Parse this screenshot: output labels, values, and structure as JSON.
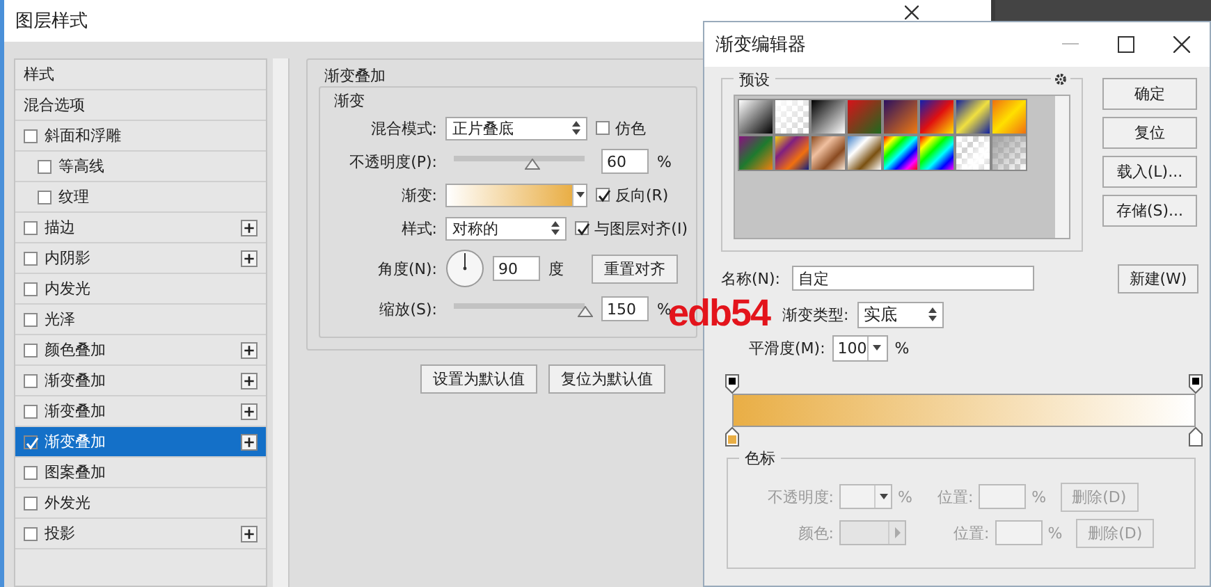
{
  "dialog": {
    "title": "图层样式"
  },
  "styles_list": [
    {
      "label": "样式",
      "kind": "header",
      "selected": false
    },
    {
      "label": "混合选项",
      "kind": "header",
      "selected": false
    },
    {
      "label": "斜面和浮雕",
      "kind": "check",
      "checked": false,
      "selected": false,
      "addable": false
    },
    {
      "label": "等高线",
      "kind": "subcheck",
      "checked": false,
      "selected": false,
      "addable": false
    },
    {
      "label": "纹理",
      "kind": "subcheck",
      "checked": false,
      "selected": false,
      "addable": false
    },
    {
      "label": "描边",
      "kind": "check",
      "checked": false,
      "selected": false,
      "addable": true
    },
    {
      "label": "内阴影",
      "kind": "check",
      "checked": false,
      "selected": false,
      "addable": true
    },
    {
      "label": "内发光",
      "kind": "check",
      "checked": false,
      "selected": false,
      "addable": false
    },
    {
      "label": "光泽",
      "kind": "check",
      "checked": false,
      "selected": false,
      "addable": false
    },
    {
      "label": "颜色叠加",
      "kind": "check",
      "checked": false,
      "selected": false,
      "addable": true
    },
    {
      "label": "渐变叠加",
      "kind": "check",
      "checked": false,
      "selected": false,
      "addable": true
    },
    {
      "label": "渐变叠加",
      "kind": "check",
      "checked": false,
      "selected": false,
      "addable": true
    },
    {
      "label": "渐变叠加",
      "kind": "check",
      "checked": true,
      "selected": true,
      "addable": true
    },
    {
      "label": "图案叠加",
      "kind": "check",
      "checked": false,
      "selected": false,
      "addable": false
    },
    {
      "label": "外发光",
      "kind": "check",
      "checked": false,
      "selected": false,
      "addable": false
    },
    {
      "label": "投影",
      "kind": "check",
      "checked": false,
      "selected": false,
      "addable": true
    }
  ],
  "gradient_overlay": {
    "title": "渐变叠加",
    "group_title": "渐变",
    "blend_mode": {
      "label": "混合模式:",
      "value": "正片叠底"
    },
    "dither": {
      "label": "仿色",
      "checked": false
    },
    "opacity": {
      "label": "不透明度(P):",
      "level": 0.6,
      "value": "60",
      "unit": "%"
    },
    "gradient": {
      "label": "渐变:"
    },
    "reverse": {
      "label": "反向(R)",
      "checked": true
    },
    "style": {
      "label": "样式:",
      "value": "对称的"
    },
    "align": {
      "label": "与图层对齐(I)",
      "checked": true
    },
    "angle": {
      "label": "角度(N):",
      "value": "90",
      "unit": "度"
    },
    "reset_align": "重置对齐",
    "scale": {
      "label": "缩放(S):",
      "level": 1,
      "value": "150",
      "unit": "%"
    },
    "buttons": [
      "设置为默认值",
      "复位为默认值"
    ]
  },
  "annotation": "edb54",
  "gradient_editor": {
    "title": "渐变编辑器",
    "presets_title": "预设",
    "presets": [
      {
        "kind": "gradient"
      },
      {
        "kind": "transparent"
      },
      {
        "kind": "gradient"
      },
      {
        "kind": "gradient"
      },
      {
        "kind": "gradient"
      },
      {
        "kind": "gradient"
      },
      {
        "kind": "gradient"
      },
      {
        "kind": "gradient"
      },
      {
        "kind": "gradient"
      },
      {
        "kind": "gradient"
      },
      {
        "kind": "gradient"
      },
      {
        "kind": "gradient"
      },
      {
        "kind": "gradient"
      },
      {
        "kind": "transparent"
      },
      {
        "kind": "transparent"
      },
      {
        "kind": "transparent"
      }
    ],
    "buttons": [
      "确定",
      "复位",
      "载入(L)...",
      "存储(S)..."
    ],
    "name": {
      "label": "名称(N):",
      "value": "自定"
    },
    "new_button": "新建(W)",
    "type": {
      "label": "渐变类型:",
      "value": "实底"
    },
    "smoothness": {
      "label": "平滑度(M):",
      "value": "100",
      "unit": "%"
    },
    "opacity_stops": [
      {
        "level": 0
      },
      {
        "level": 1
      }
    ],
    "color_stops": [
      {
        "level": 0,
        "color": "#e9ae45"
      },
      {
        "level": 1,
        "color": "#ffffff"
      }
    ],
    "stops_group": {
      "title": "色标",
      "disabled": true,
      "rows": [
        {
          "kind": "opacity",
          "label": "不透明度:",
          "unit": "%",
          "position_label": "位置:",
          "position_unit": "%",
          "delete": "删除(D)"
        },
        {
          "kind": "color",
          "label": "颜色:",
          "position_label": "位置:",
          "position_unit": "%",
          "delete": "删除(D)"
        }
      ]
    }
  }
}
